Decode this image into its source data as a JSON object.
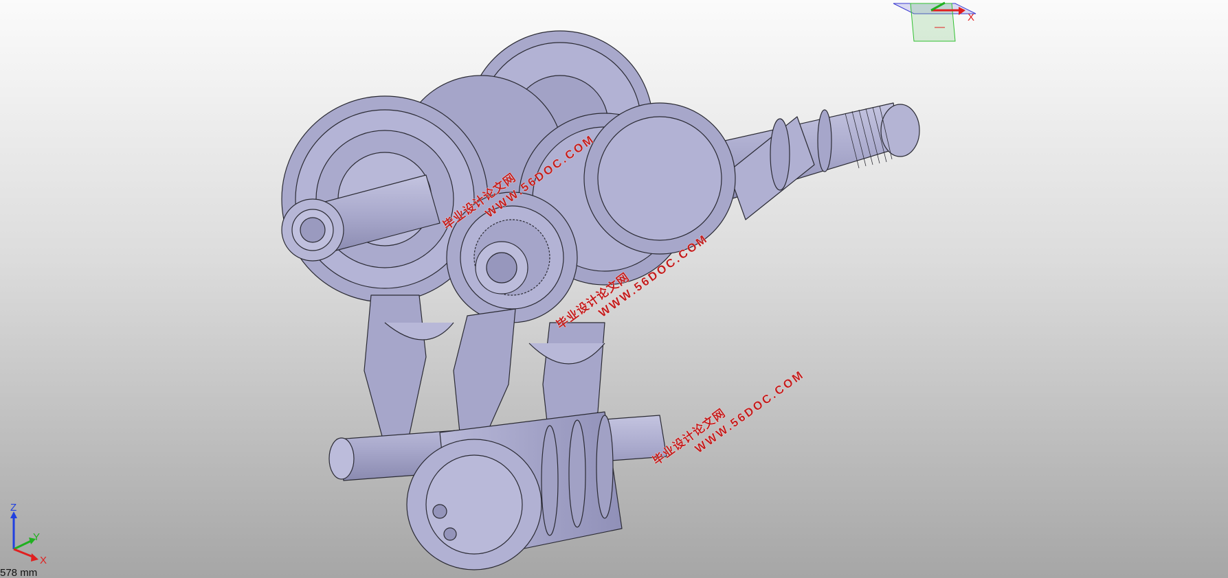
{
  "viewport": {
    "background_top": "#fbfbfb",
    "background_bottom": "#a6a6a6",
    "model_fill": "#aaaacc",
    "edge_color": "#2a2a33"
  },
  "triad": {
    "x_label": "X",
    "y_label": "Y",
    "z_label": "Z",
    "x_color": "#e02020",
    "y_color": "#20b020",
    "z_color": "#2040e0"
  },
  "ref_triad": {
    "x_label": "X"
  },
  "scale_label": "578 mm",
  "watermarks": [
    {
      "cn": "毕业设计论文网",
      "url": "WWW.56DOC.COM"
    },
    {
      "cn": "毕业设计论文网",
      "url": "WWW.56DOC.COM"
    },
    {
      "cn": "毕业设计论文网",
      "url": "WWW.56DOC.COM"
    }
  ]
}
